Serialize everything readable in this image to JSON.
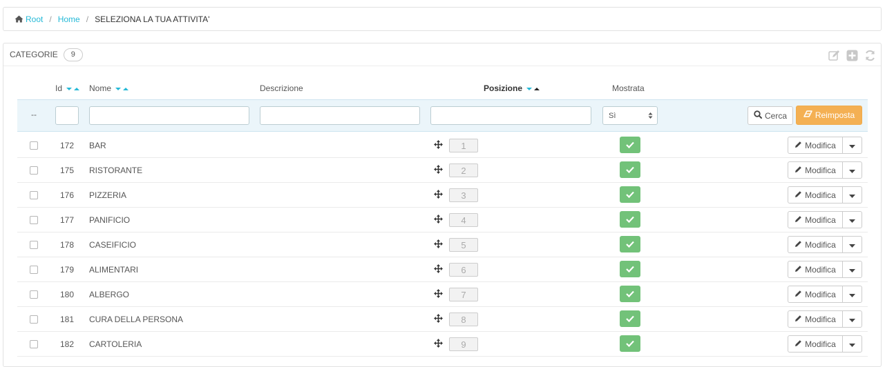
{
  "breadcrumb": {
    "items": [
      {
        "label": "Root",
        "icon": "home-icon"
      },
      {
        "label": "Home"
      },
      {
        "label": "SELEZIONA LA TUA ATTIVITA'"
      }
    ]
  },
  "panel": {
    "title": "CATEGORIE",
    "count": "9",
    "tools": [
      "edit-icon",
      "add-icon",
      "refresh-icon"
    ]
  },
  "columns": {
    "id": "Id",
    "name": "Nome",
    "description": "Descrizione",
    "position": "Posizione",
    "shown": "Mostrata"
  },
  "filters": {
    "dash": "--",
    "shown_value": "Sì",
    "search_label": "Cerca",
    "reset_label": "Reimposta"
  },
  "rows": [
    {
      "id": "172",
      "name": "BAR",
      "position": "1"
    },
    {
      "id": "175",
      "name": "RISTORANTE",
      "position": "2"
    },
    {
      "id": "176",
      "name": "PIZZERIA",
      "position": "3"
    },
    {
      "id": "177",
      "name": "PANIFICIO",
      "position": "4"
    },
    {
      "id": "178",
      "name": "CASEIFICIO",
      "position": "5"
    },
    {
      "id": "179",
      "name": "ALIMENTARI",
      "position": "6"
    },
    {
      "id": "180",
      "name": "ALBERGO",
      "position": "7"
    },
    {
      "id": "181",
      "name": "CURA DELLA PERSONA",
      "position": "8"
    },
    {
      "id": "182",
      "name": "CARTOLERIA",
      "position": "9"
    }
  ],
  "row_action_label": "Modifica",
  "colors": {
    "link": "#25b9d7",
    "shown_bg": "#72c279",
    "reset_bg": "#f4b053",
    "filter_bg": "#ebf5fa"
  }
}
